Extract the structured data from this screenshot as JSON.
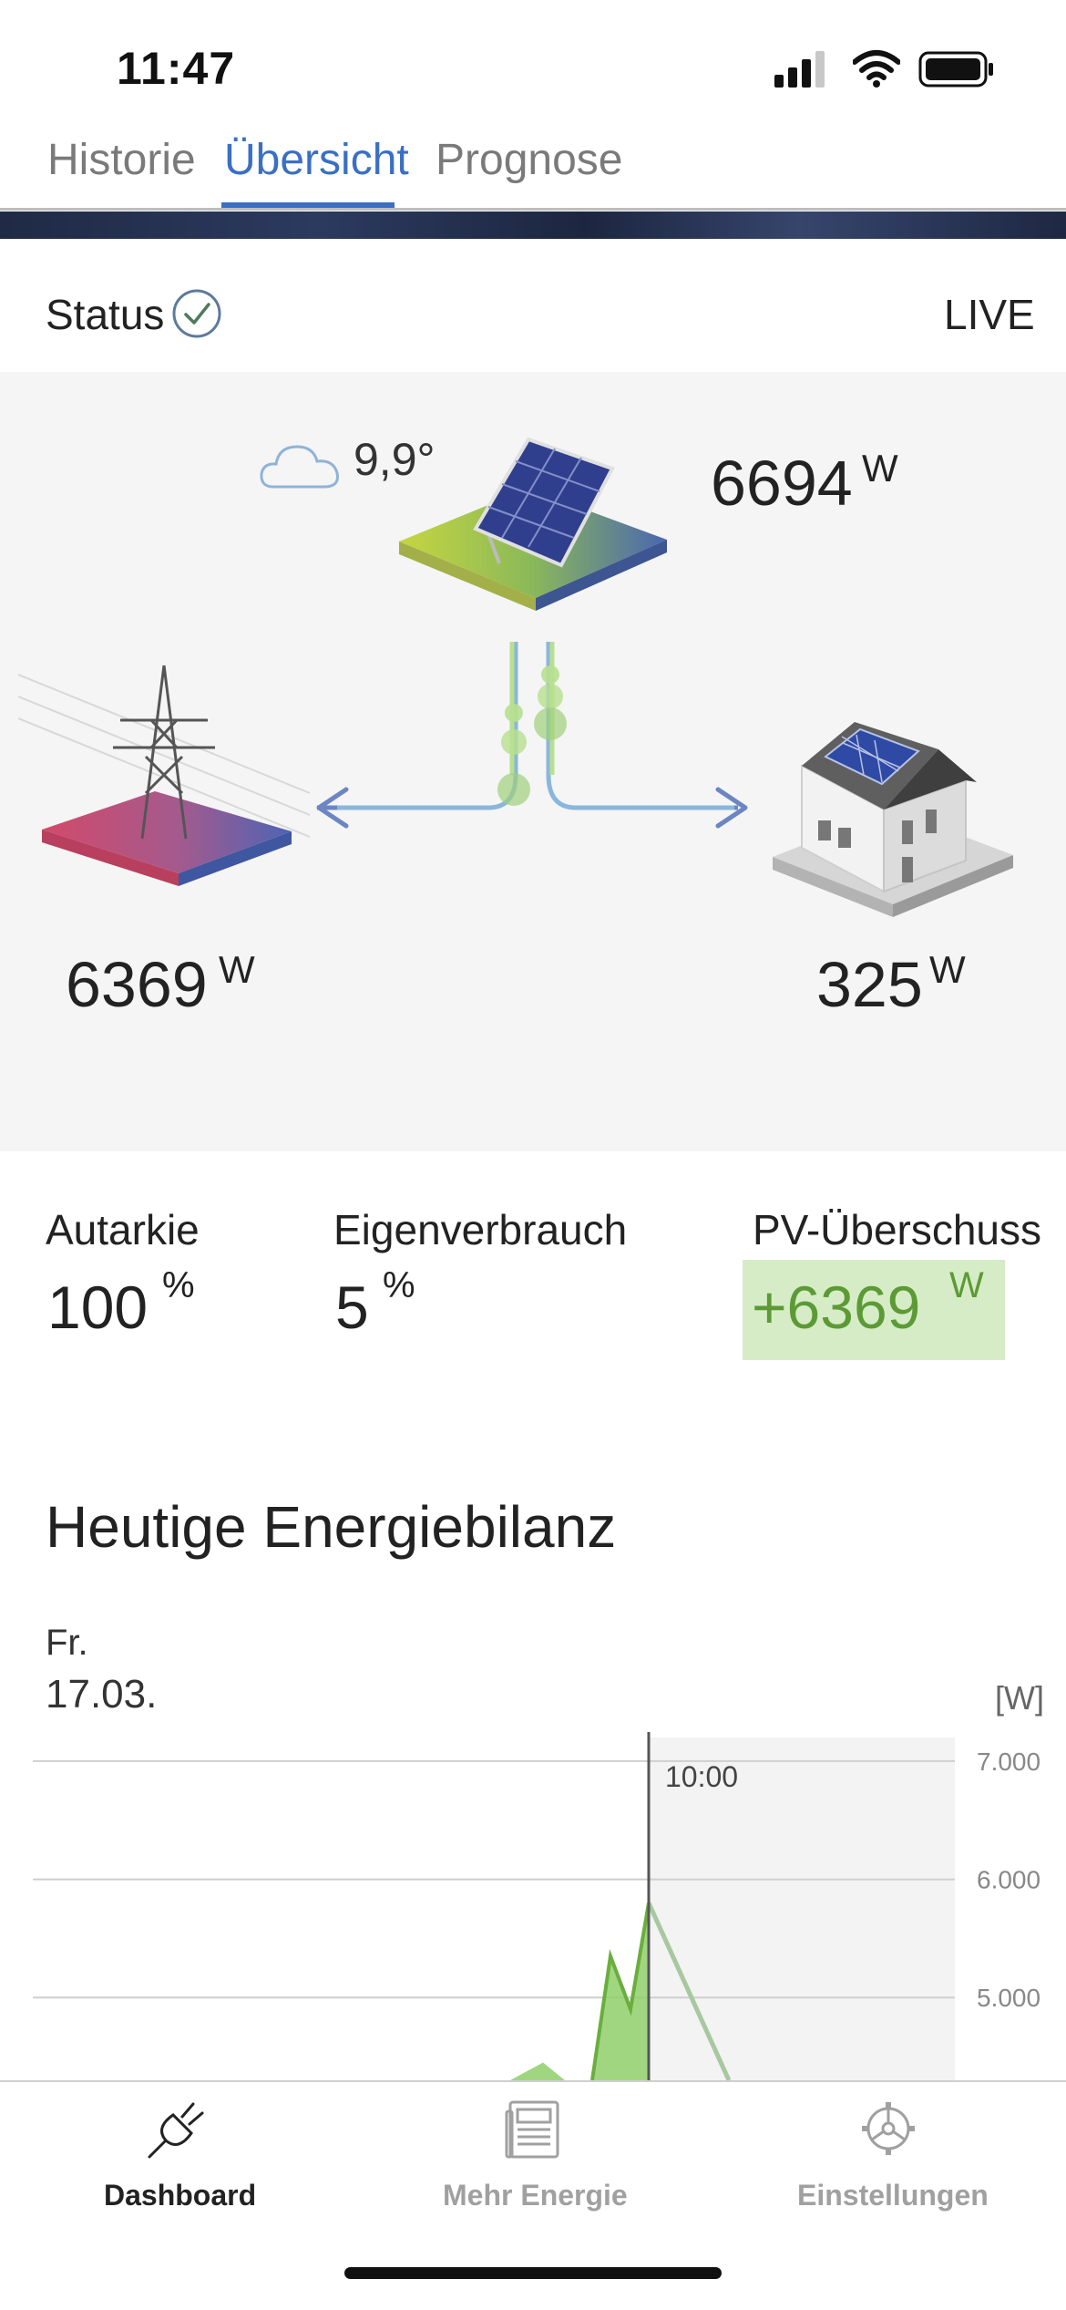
{
  "status_bar": {
    "time": "11:47"
  },
  "tabs": [
    {
      "label": "Historie",
      "active": false
    },
    {
      "label": "Übersicht",
      "active": true
    },
    {
      "label": "Prognose",
      "active": false
    }
  ],
  "status": {
    "label": "Status",
    "live_label": "LIVE"
  },
  "flow": {
    "weather": {
      "icon": "cloud-icon",
      "temperature": "9,9°"
    },
    "pv": {
      "value": "6694",
      "unit": "W"
    },
    "grid": {
      "value": "6369",
      "unit": "W"
    },
    "house": {
      "value": "325",
      "unit": "W"
    }
  },
  "kpis": {
    "autarkie": {
      "label": "Autarkie",
      "value": "100",
      "unit": "%"
    },
    "eigenverbrauch": {
      "label": "Eigenverbrauch",
      "value": "5",
      "unit": "%"
    },
    "pv_surplus": {
      "label": "PV-Überschuss",
      "value": "+6369",
      "unit": "W",
      "color": "#5c9a36",
      "background": "#d6ecc6"
    }
  },
  "energy_balance": {
    "title": "Heutige Energiebilanz",
    "day": "Fr.",
    "date": "17.03.",
    "unit_label": "[W]",
    "current_time_label": "10:00"
  },
  "chart_data": {
    "type": "area",
    "y_ticks": [
      "7.000",
      "6.000",
      "5.000"
    ],
    "ylim_visible": [
      4300,
      7200
    ],
    "series": [
      {
        "values_visible_peak": [
          4450,
          5350,
          4900,
          5800
        ],
        "color": "#8fcf6a"
      }
    ],
    "forecast_color": "#a8c8a0"
  },
  "bottom_nav": [
    {
      "label": "Dashboard",
      "icon": "plug-icon",
      "active": true
    },
    {
      "label": "Mehr Energie",
      "icon": "newspaper-icon",
      "active": false
    },
    {
      "label": "Einstellungen",
      "icon": "gear-icon",
      "active": false
    }
  ],
  "colors": {
    "accent": "#3a6fc4",
    "surplus_green": "#5c9a36",
    "inactive_gray": "#a0a0a0"
  }
}
